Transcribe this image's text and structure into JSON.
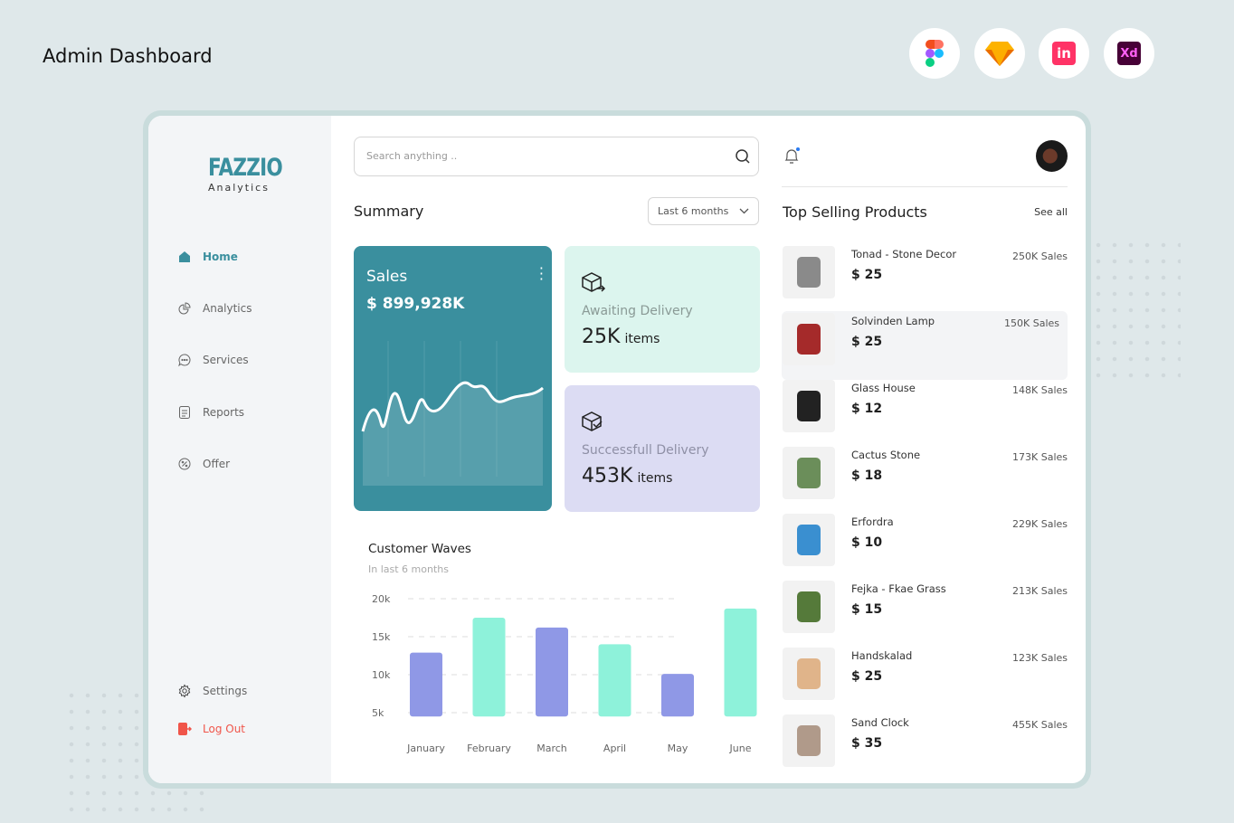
{
  "page_title": "Admin Dashboard",
  "tools": [
    {
      "name": "figma-icon"
    },
    {
      "name": "sketch-icon"
    },
    {
      "name": "invision-icon",
      "label": "in"
    },
    {
      "name": "adobe-xd-icon",
      "label": "Xd"
    }
  ],
  "brand": {
    "name": "FAZZIO",
    "sub": "Analytics",
    "color": "#3a8f9e"
  },
  "sidebar": {
    "items": [
      {
        "label": "Home",
        "icon": "home-icon",
        "active": true
      },
      {
        "label": "Analytics",
        "icon": "pie-chart-icon"
      },
      {
        "label": "Services",
        "icon": "chat-icon"
      },
      {
        "label": "Reports",
        "icon": "document-icon"
      },
      {
        "label": "Offer",
        "icon": "discount-icon"
      }
    ],
    "settings": "Settings",
    "logout": "Log Out"
  },
  "search": {
    "placeholder": "Search anything .."
  },
  "summary": {
    "title": "Summary",
    "period": "Last 6 months",
    "sales": {
      "label": "Sales",
      "value": "$ 899,928K"
    },
    "awaiting": {
      "label": "Awaiting Delivery",
      "value": "25K",
      "unit": "items"
    },
    "success": {
      "label": "Successfull Delivery",
      "value": "453K",
      "unit": "items"
    }
  },
  "chart_data": {
    "type": "bar",
    "title": "Customer Waves",
    "subtitle": "In last 6 months",
    "categories": [
      "January",
      "February",
      "March",
      "April",
      "May",
      "June"
    ],
    "values": [
      12900,
      17500,
      16200,
      14000,
      10100,
      18700
    ],
    "yticks": [
      "20k",
      "15k",
      "10k",
      "5k"
    ],
    "ylim": [
      5000,
      20000
    ],
    "grid": true,
    "colors": [
      "#8f98e6",
      "#8ef2da"
    ]
  },
  "top": {
    "title": "Top Selling Products",
    "see_all": "See all",
    "products": [
      {
        "name": "Tonad - Stone Decor",
        "price": "$ 25",
        "sales": "250K Sales"
      },
      {
        "name": "Solvinden Lamp",
        "price": "$ 25",
        "sales": "150K Sales"
      },
      {
        "name": "Glass House",
        "price": "$ 12",
        "sales": "148K Sales"
      },
      {
        "name": "Cactus Stone",
        "price": "$ 18",
        "sales": "173K Sales"
      },
      {
        "name": "Erfordra",
        "price": "$ 10",
        "sales": "229K Sales"
      },
      {
        "name": "Fejka - Fkae Grass",
        "price": "$ 15",
        "sales": "213K Sales"
      },
      {
        "name": "Handskalad",
        "price": "$ 25",
        "sales": "123K Sales"
      },
      {
        "name": "Sand Clock",
        "price": "$ 35",
        "sales": "455K Sales"
      }
    ]
  }
}
